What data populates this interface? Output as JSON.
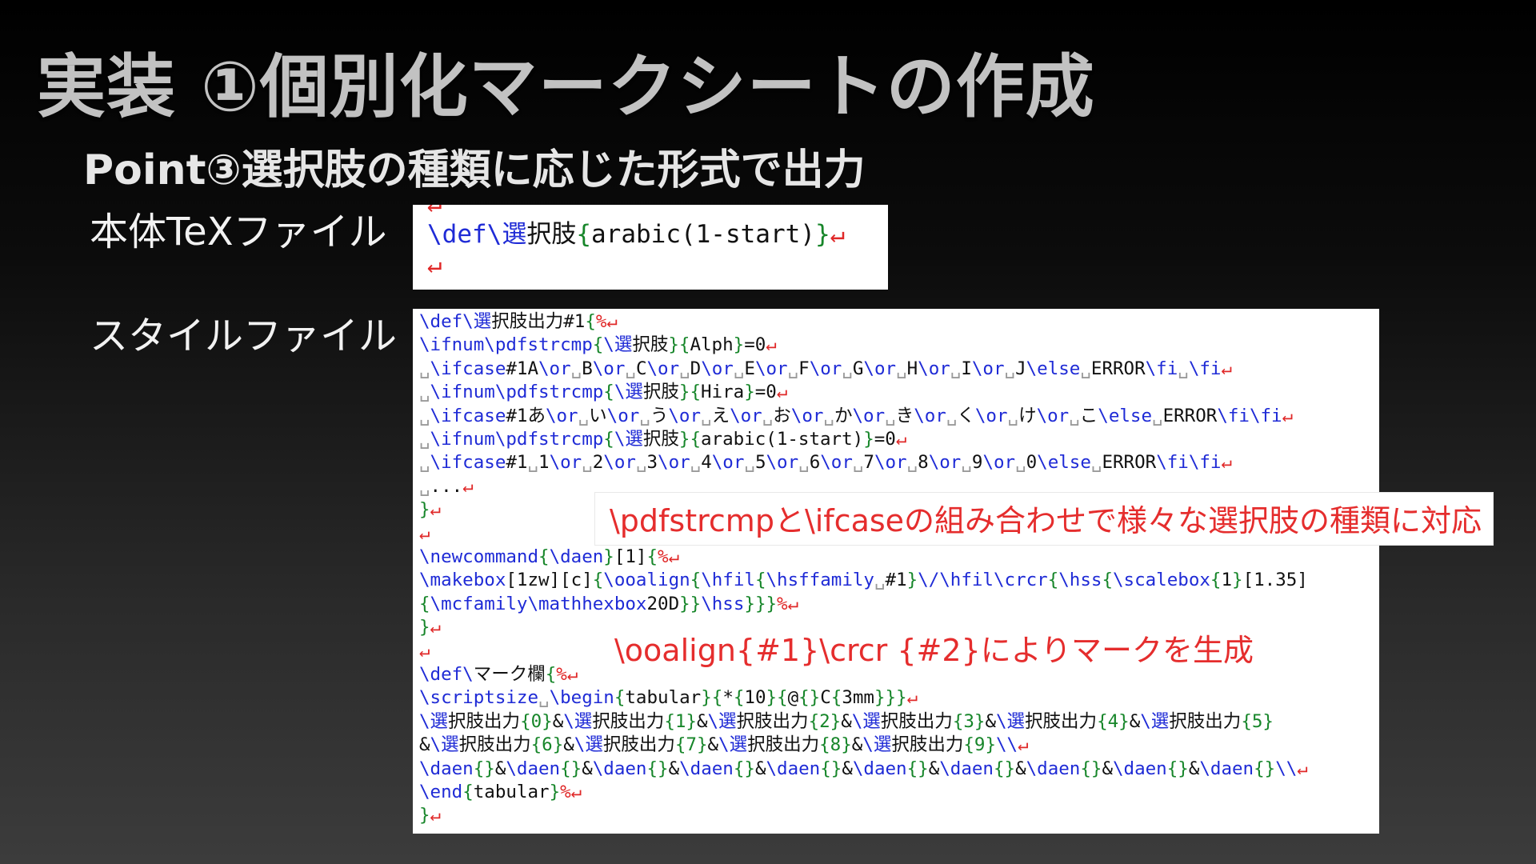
{
  "slide": {
    "title": "実装 ①個別化マークシートの作成",
    "subtitle": "Point③選択肢の種類に応じた形式で出力",
    "label_main": "本体TeXファイル",
    "label_style": "スタイルファイル"
  },
  "colors": {
    "keyword": "#1f2bd6",
    "brace": "#17862a",
    "newline_mark": "#e02828",
    "annotation": "#e52d2d"
  },
  "main_tex": {
    "lines": [
      [
        {
          "t": "↵",
          "c": "nl"
        }
      ],
      [
        {
          "t": "\\def\\選",
          "c": "kw"
        },
        {
          "t": "択肢",
          "c": "tx"
        },
        {
          "t": "{",
          "c": "br"
        },
        {
          "t": "arabic(1-start)",
          "c": "tx"
        },
        {
          "t": "}",
          "c": "br"
        },
        {
          "t": "↵",
          "c": "nl"
        }
      ],
      [
        {
          "t": "↵",
          "c": "nl"
        }
      ]
    ]
  },
  "style_file": {
    "lines": [
      [
        {
          "t": "\\def\\選",
          "c": "kw"
        },
        {
          "t": "択肢出力#1",
          "c": "tx"
        },
        {
          "t": "{",
          "c": "br"
        },
        {
          "t": "%",
          "c": "nl"
        },
        {
          "t": "↵",
          "c": "nl"
        }
      ],
      [
        {
          "t": "\\ifnum\\pdfstrcmp",
          "c": "kw"
        },
        {
          "t": "{",
          "c": "br"
        },
        {
          "t": "\\選",
          "c": "kw"
        },
        {
          "t": "択肢",
          "c": "tx"
        },
        {
          "t": "}{",
          "c": "br"
        },
        {
          "t": "Alph",
          "c": "tx"
        },
        {
          "t": "}",
          "c": "br"
        },
        {
          "t": "=0",
          "c": "tx"
        },
        {
          "t": "↵",
          "c": "nl"
        }
      ],
      [
        {
          "t": "␣",
          "c": "sp"
        },
        {
          "t": "\\ifcase",
          "c": "kw"
        },
        {
          "t": "#1A",
          "c": "tx"
        },
        {
          "t": "\\or",
          "c": "kw"
        },
        {
          "t": "␣",
          "c": "sp"
        },
        {
          "t": "B",
          "c": "tx"
        },
        {
          "t": "\\or",
          "c": "kw"
        },
        {
          "t": "␣",
          "c": "sp"
        },
        {
          "t": "C",
          "c": "tx"
        },
        {
          "t": "\\or",
          "c": "kw"
        },
        {
          "t": "␣",
          "c": "sp"
        },
        {
          "t": "D",
          "c": "tx"
        },
        {
          "t": "\\or",
          "c": "kw"
        },
        {
          "t": "␣",
          "c": "sp"
        },
        {
          "t": "E",
          "c": "tx"
        },
        {
          "t": "\\or",
          "c": "kw"
        },
        {
          "t": "␣",
          "c": "sp"
        },
        {
          "t": "F",
          "c": "tx"
        },
        {
          "t": "\\or",
          "c": "kw"
        },
        {
          "t": "␣",
          "c": "sp"
        },
        {
          "t": "G",
          "c": "tx"
        },
        {
          "t": "\\or",
          "c": "kw"
        },
        {
          "t": "␣",
          "c": "sp"
        },
        {
          "t": "H",
          "c": "tx"
        },
        {
          "t": "\\or",
          "c": "kw"
        },
        {
          "t": "␣",
          "c": "sp"
        },
        {
          "t": "I",
          "c": "tx"
        },
        {
          "t": "\\or",
          "c": "kw"
        },
        {
          "t": "␣",
          "c": "sp"
        },
        {
          "t": "J",
          "c": "tx"
        },
        {
          "t": "\\else",
          "c": "kw"
        },
        {
          "t": "␣",
          "c": "sp"
        },
        {
          "t": "ERROR",
          "c": "tx"
        },
        {
          "t": "\\fi",
          "c": "kw"
        },
        {
          "t": "␣",
          "c": "sp"
        },
        {
          "t": "\\fi",
          "c": "kw"
        },
        {
          "t": "↵",
          "c": "nl"
        }
      ],
      [
        {
          "t": "␣",
          "c": "sp"
        },
        {
          "t": "\\ifnum\\pdfstrcmp",
          "c": "kw"
        },
        {
          "t": "{",
          "c": "br"
        },
        {
          "t": "\\選",
          "c": "kw"
        },
        {
          "t": "択肢",
          "c": "tx"
        },
        {
          "t": "}{",
          "c": "br"
        },
        {
          "t": "Hira",
          "c": "tx"
        },
        {
          "t": "}",
          "c": "br"
        },
        {
          "t": "=0",
          "c": "tx"
        },
        {
          "t": "↵",
          "c": "nl"
        }
      ],
      [
        {
          "t": "␣",
          "c": "sp"
        },
        {
          "t": "\\ifcase",
          "c": "kw"
        },
        {
          "t": "#1あ",
          "c": "tx"
        },
        {
          "t": "\\or",
          "c": "kw"
        },
        {
          "t": "␣",
          "c": "sp"
        },
        {
          "t": "い",
          "c": "tx"
        },
        {
          "t": "\\or",
          "c": "kw"
        },
        {
          "t": "␣",
          "c": "sp"
        },
        {
          "t": "う",
          "c": "tx"
        },
        {
          "t": "\\or",
          "c": "kw"
        },
        {
          "t": "␣",
          "c": "sp"
        },
        {
          "t": "え",
          "c": "tx"
        },
        {
          "t": "\\or",
          "c": "kw"
        },
        {
          "t": "␣",
          "c": "sp"
        },
        {
          "t": "お",
          "c": "tx"
        },
        {
          "t": "\\or",
          "c": "kw"
        },
        {
          "t": "␣",
          "c": "sp"
        },
        {
          "t": "か",
          "c": "tx"
        },
        {
          "t": "\\or",
          "c": "kw"
        },
        {
          "t": "␣",
          "c": "sp"
        },
        {
          "t": "き",
          "c": "tx"
        },
        {
          "t": "\\or",
          "c": "kw"
        },
        {
          "t": "␣",
          "c": "sp"
        },
        {
          "t": "く",
          "c": "tx"
        },
        {
          "t": "\\or",
          "c": "kw"
        },
        {
          "t": "␣",
          "c": "sp"
        },
        {
          "t": "け",
          "c": "tx"
        },
        {
          "t": "\\or",
          "c": "kw"
        },
        {
          "t": "␣",
          "c": "sp"
        },
        {
          "t": "こ",
          "c": "tx"
        },
        {
          "t": "\\else",
          "c": "kw"
        },
        {
          "t": "␣",
          "c": "sp"
        },
        {
          "t": "ERROR",
          "c": "tx"
        },
        {
          "t": "\\fi\\fi",
          "c": "kw"
        },
        {
          "t": "↵",
          "c": "nl"
        }
      ],
      [
        {
          "t": "␣",
          "c": "sp"
        },
        {
          "t": "\\ifnum\\pdfstrcmp",
          "c": "kw"
        },
        {
          "t": "{",
          "c": "br"
        },
        {
          "t": "\\選",
          "c": "kw"
        },
        {
          "t": "択肢",
          "c": "tx"
        },
        {
          "t": "}{",
          "c": "br"
        },
        {
          "t": "arabic(1-start)",
          "c": "tx"
        },
        {
          "t": "}",
          "c": "br"
        },
        {
          "t": "=0",
          "c": "tx"
        },
        {
          "t": "↵",
          "c": "nl"
        }
      ],
      [
        {
          "t": "␣",
          "c": "sp"
        },
        {
          "t": "\\ifcase",
          "c": "kw"
        },
        {
          "t": "#1",
          "c": "tx"
        },
        {
          "t": "␣",
          "c": "sp"
        },
        {
          "t": "1",
          "c": "tx"
        },
        {
          "t": "\\or",
          "c": "kw"
        },
        {
          "t": "␣",
          "c": "sp"
        },
        {
          "t": "2",
          "c": "tx"
        },
        {
          "t": "\\or",
          "c": "kw"
        },
        {
          "t": "␣",
          "c": "sp"
        },
        {
          "t": "3",
          "c": "tx"
        },
        {
          "t": "\\or",
          "c": "kw"
        },
        {
          "t": "␣",
          "c": "sp"
        },
        {
          "t": "4",
          "c": "tx"
        },
        {
          "t": "\\or",
          "c": "kw"
        },
        {
          "t": "␣",
          "c": "sp"
        },
        {
          "t": "5",
          "c": "tx"
        },
        {
          "t": "\\or",
          "c": "kw"
        },
        {
          "t": "␣",
          "c": "sp"
        },
        {
          "t": "6",
          "c": "tx"
        },
        {
          "t": "\\or",
          "c": "kw"
        },
        {
          "t": "␣",
          "c": "sp"
        },
        {
          "t": "7",
          "c": "tx"
        },
        {
          "t": "\\or",
          "c": "kw"
        },
        {
          "t": "␣",
          "c": "sp"
        },
        {
          "t": "8",
          "c": "tx"
        },
        {
          "t": "\\or",
          "c": "kw"
        },
        {
          "t": "␣",
          "c": "sp"
        },
        {
          "t": "9",
          "c": "tx"
        },
        {
          "t": "\\or",
          "c": "kw"
        },
        {
          "t": "␣",
          "c": "sp"
        },
        {
          "t": "0",
          "c": "tx"
        },
        {
          "t": "\\else",
          "c": "kw"
        },
        {
          "t": "␣",
          "c": "sp"
        },
        {
          "t": "ERROR",
          "c": "tx"
        },
        {
          "t": "\\fi\\fi",
          "c": "kw"
        },
        {
          "t": "↵",
          "c": "nl"
        }
      ],
      [
        {
          "t": "␣",
          "c": "sp"
        },
        {
          "t": "...",
          "c": "tx"
        },
        {
          "t": "↵",
          "c": "nl"
        }
      ],
      [
        {
          "t": "}",
          "c": "br"
        },
        {
          "t": "↵",
          "c": "nl"
        }
      ],
      [
        {
          "t": "↵",
          "c": "nl"
        }
      ],
      [
        {
          "t": "\\newcommand",
          "c": "kw"
        },
        {
          "t": "{",
          "c": "br"
        },
        {
          "t": "\\daen",
          "c": "kw"
        },
        {
          "t": "}",
          "c": "br"
        },
        {
          "t": "[1]",
          "c": "tx"
        },
        {
          "t": "{",
          "c": "br"
        },
        {
          "t": "%",
          "c": "nl"
        },
        {
          "t": "↵",
          "c": "nl"
        }
      ],
      [
        {
          "t": "\\makebox",
          "c": "kw"
        },
        {
          "t": "[1zw][c]",
          "c": "tx"
        },
        {
          "t": "{",
          "c": "br"
        },
        {
          "t": "\\ooalign",
          "c": "kw"
        },
        {
          "t": "{",
          "c": "br"
        },
        {
          "t": "\\hfil",
          "c": "kw"
        },
        {
          "t": "{",
          "c": "br"
        },
        {
          "t": "\\hsffamily",
          "c": "kw"
        },
        {
          "t": "␣",
          "c": "sp"
        },
        {
          "t": "#1",
          "c": "tx"
        },
        {
          "t": "}",
          "c": "br"
        },
        {
          "t": "\\/\\hfil\\crcr",
          "c": "kw"
        },
        {
          "t": "{",
          "c": "br"
        },
        {
          "t": "\\hss",
          "c": "kw"
        },
        {
          "t": "{",
          "c": "br"
        },
        {
          "t": "\\scalebox",
          "c": "kw"
        },
        {
          "t": "{",
          "c": "br"
        },
        {
          "t": "1",
          "c": "tx"
        },
        {
          "t": "}",
          "c": "br"
        },
        {
          "t": "[1.35]",
          "c": "tx"
        }
      ],
      [
        {
          "t": "{",
          "c": "br"
        },
        {
          "t": "\\mcfamily\\mathhexbox",
          "c": "kw"
        },
        {
          "t": "20D",
          "c": "tx"
        },
        {
          "t": "}}",
          "c": "br"
        },
        {
          "t": "\\hss",
          "c": "kw"
        },
        {
          "t": "}}}",
          "c": "br"
        },
        {
          "t": "%",
          "c": "nl"
        },
        {
          "t": "↵",
          "c": "nl"
        }
      ],
      [
        {
          "t": "}",
          "c": "br"
        },
        {
          "t": "↵",
          "c": "nl"
        }
      ],
      [
        {
          "t": "↵",
          "c": "nl"
        }
      ],
      [
        {
          "t": "\\def\\",
          "c": "kw"
        },
        {
          "t": "マーク欄",
          "c": "tx"
        },
        {
          "t": "{",
          "c": "br"
        },
        {
          "t": "%",
          "c": "nl"
        },
        {
          "t": "↵",
          "c": "nl"
        }
      ],
      [
        {
          "t": "\\scriptsize",
          "c": "kw"
        },
        {
          "t": "␣",
          "c": "sp"
        },
        {
          "t": "\\begin",
          "c": "kw"
        },
        {
          "t": "{",
          "c": "br"
        },
        {
          "t": "tabular",
          "c": "tx"
        },
        {
          "t": "}{",
          "c": "br"
        },
        {
          "t": "*",
          "c": "tx"
        },
        {
          "t": "{",
          "c": "br"
        },
        {
          "t": "10",
          "c": "tx"
        },
        {
          "t": "}{",
          "c": "br"
        },
        {
          "t": "@",
          "c": "tx"
        },
        {
          "t": "{}",
          "c": "br"
        },
        {
          "t": "C",
          "c": "tx"
        },
        {
          "t": "{",
          "c": "br"
        },
        {
          "t": "3mm",
          "c": "tx"
        },
        {
          "t": "}}}",
          "c": "br"
        },
        {
          "t": "↵",
          "c": "nl"
        }
      ],
      [
        {
          "t": "\\選",
          "c": "kw"
        },
        {
          "t": "択肢出力",
          "c": "tx"
        },
        {
          "t": "{0}",
          "c": "br"
        },
        {
          "t": "&",
          "c": "tx"
        },
        {
          "t": "\\選",
          "c": "kw"
        },
        {
          "t": "択肢出力",
          "c": "tx"
        },
        {
          "t": "{1}",
          "c": "br"
        },
        {
          "t": "&",
          "c": "tx"
        },
        {
          "t": "\\選",
          "c": "kw"
        },
        {
          "t": "択肢出力",
          "c": "tx"
        },
        {
          "t": "{2}",
          "c": "br"
        },
        {
          "t": "&",
          "c": "tx"
        },
        {
          "t": "\\選",
          "c": "kw"
        },
        {
          "t": "択肢出力",
          "c": "tx"
        },
        {
          "t": "{3}",
          "c": "br"
        },
        {
          "t": "&",
          "c": "tx"
        },
        {
          "t": "\\選",
          "c": "kw"
        },
        {
          "t": "択肢出力",
          "c": "tx"
        },
        {
          "t": "{4}",
          "c": "br"
        },
        {
          "t": "&",
          "c": "tx"
        },
        {
          "t": "\\選",
          "c": "kw"
        },
        {
          "t": "択肢出力",
          "c": "tx"
        },
        {
          "t": "{5}",
          "c": "br"
        }
      ],
      [
        {
          "t": "&",
          "c": "tx"
        },
        {
          "t": "\\選",
          "c": "kw"
        },
        {
          "t": "択肢出力",
          "c": "tx"
        },
        {
          "t": "{6}",
          "c": "br"
        },
        {
          "t": "&",
          "c": "tx"
        },
        {
          "t": "\\選",
          "c": "kw"
        },
        {
          "t": "択肢出力",
          "c": "tx"
        },
        {
          "t": "{7}",
          "c": "br"
        },
        {
          "t": "&",
          "c": "tx"
        },
        {
          "t": "\\選",
          "c": "kw"
        },
        {
          "t": "択肢出力",
          "c": "tx"
        },
        {
          "t": "{8}",
          "c": "br"
        },
        {
          "t": "&",
          "c": "tx"
        },
        {
          "t": "\\選",
          "c": "kw"
        },
        {
          "t": "択肢出力",
          "c": "tx"
        },
        {
          "t": "{9}",
          "c": "br"
        },
        {
          "t": "\\\\",
          "c": "kw"
        },
        {
          "t": "↵",
          "c": "nl"
        }
      ],
      [
        {
          "t": "\\daen",
          "c": "kw"
        },
        {
          "t": "{}",
          "c": "br"
        },
        {
          "t": "&",
          "c": "tx"
        },
        {
          "t": "\\daen",
          "c": "kw"
        },
        {
          "t": "{}",
          "c": "br"
        },
        {
          "t": "&",
          "c": "tx"
        },
        {
          "t": "\\daen",
          "c": "kw"
        },
        {
          "t": "{}",
          "c": "br"
        },
        {
          "t": "&",
          "c": "tx"
        },
        {
          "t": "\\daen",
          "c": "kw"
        },
        {
          "t": "{}",
          "c": "br"
        },
        {
          "t": "&",
          "c": "tx"
        },
        {
          "t": "\\daen",
          "c": "kw"
        },
        {
          "t": "{}",
          "c": "br"
        },
        {
          "t": "&",
          "c": "tx"
        },
        {
          "t": "\\daen",
          "c": "kw"
        },
        {
          "t": "{}",
          "c": "br"
        },
        {
          "t": "&",
          "c": "tx"
        },
        {
          "t": "\\daen",
          "c": "kw"
        },
        {
          "t": "{}",
          "c": "br"
        },
        {
          "t": "&",
          "c": "tx"
        },
        {
          "t": "\\daen",
          "c": "kw"
        },
        {
          "t": "{}",
          "c": "br"
        },
        {
          "t": "&",
          "c": "tx"
        },
        {
          "t": "\\daen",
          "c": "kw"
        },
        {
          "t": "{}",
          "c": "br"
        },
        {
          "t": "&",
          "c": "tx"
        },
        {
          "t": "\\daen",
          "c": "kw"
        },
        {
          "t": "{}",
          "c": "br"
        },
        {
          "t": "\\\\",
          "c": "kw"
        },
        {
          "t": "↵",
          "c": "nl"
        }
      ],
      [
        {
          "t": "\\end",
          "c": "kw"
        },
        {
          "t": "{",
          "c": "br"
        },
        {
          "t": "tabular",
          "c": "tx"
        },
        {
          "t": "}",
          "c": "br"
        },
        {
          "t": "%",
          "c": "nl"
        },
        {
          "t": "↵",
          "c": "nl"
        }
      ],
      [
        {
          "t": "}",
          "c": "br"
        },
        {
          "t": "↵",
          "c": "nl"
        }
      ]
    ]
  },
  "annotations": {
    "first": "\\pdfstrcmpと\\ifcaseの組み合わせで様々な選択肢の種類に対応",
    "second": "\\ooalign{#1}\\crcr {#2}によりマークを生成"
  }
}
